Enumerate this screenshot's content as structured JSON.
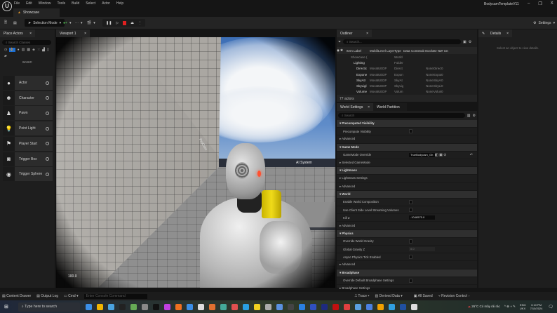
{
  "app": {
    "project_title": "BodycamTemplateV11",
    "level_tab": "Showcase"
  },
  "menu": [
    "File",
    "Edit",
    "Window",
    "Tools",
    "Build",
    "Select",
    "Actor",
    "Help"
  ],
  "toolbar": {
    "selection_mode": "Selection Mode",
    "settings": "Settings"
  },
  "place_actors": {
    "tab": "Place Actors",
    "search_placeholder": "Search Classes",
    "section": "BASIC",
    "items": [
      {
        "label": "Actor",
        "icon": "sphere-icon"
      },
      {
        "label": "Character",
        "icon": "character-icon"
      },
      {
        "label": "Pawn",
        "icon": "pawn-icon"
      },
      {
        "label": "Point Light",
        "icon": "light-bulb-icon"
      },
      {
        "label": "Player Start",
        "icon": "flag-icon"
      },
      {
        "label": "Trigger Box",
        "icon": "trigger-box-icon"
      },
      {
        "label": "Trigger Sphere",
        "icon": "trigger-sphere-icon"
      }
    ]
  },
  "viewport": {
    "tab": "Viewport 1",
    "world_text_1": "AI System",
    "world_text_2": "ProCam",
    "fov_readout": "100.0"
  },
  "outliner": {
    "tab": "Outliner",
    "search_placeholder": "Search...",
    "columns": [
      "Item Label",
      "Mobilit",
      "Level",
      "Layer",
      "Type",
      "Data L",
      "Conten",
      "Sub Pa",
      "Socket",
      "ID Nam",
      "# Unca"
    ],
    "rows": [
      [
        "Showcase (",
        "",
        "",
        "",
        "World",
        "",
        "",
        "",
        "",
        "",
        ""
      ],
      [
        "Lighting",
        "",
        "",
        "",
        "Folder",
        "",
        "",
        "",
        "",
        "",
        ""
      ],
      [
        "Directic",
        "Movat",
        "UEDPI",
        "",
        "Direct",
        "",
        "",
        "",
        "None",
        "Directi",
        "0"
      ],
      [
        "Expone",
        "Movat",
        "UEDPI",
        "",
        "Expon",
        "",
        "",
        "",
        "None",
        "Expon",
        "0"
      ],
      [
        "SkyAtr",
        "Movat",
        "UEDPI",
        "",
        "SkyAt",
        "",
        "",
        "",
        "None",
        "SkyAt",
        "0"
      ],
      [
        "SkyLigl",
        "Movat",
        "UEDPI",
        "",
        "SkyLig",
        "",
        "",
        "",
        "None",
        "SkyLig",
        "0"
      ],
      [
        "Volume",
        "Movat",
        "UEDPI",
        "",
        "Volum",
        "",
        "",
        "",
        "None",
        "Volum",
        "0"
      ]
    ],
    "count": "77 actors"
  },
  "world_settings": {
    "tab": "World Settings",
    "tab2": "World Partition",
    "search_placeholder": "Search",
    "rows": [
      {
        "type": "cat",
        "label": "Precomputed Visibility"
      },
      {
        "type": "chk",
        "label": "Precompute Visibility"
      },
      {
        "type": "sub",
        "label": "Advanced"
      },
      {
        "type": "cat",
        "label": "Game Mode"
      },
      {
        "type": "drop",
        "label": "GameMode Override",
        "value": "TrueBodycam_Gh"
      },
      {
        "type": "sub",
        "label": "Selected GameMode"
      },
      {
        "type": "cat",
        "label": "Lightmass"
      },
      {
        "type": "sub",
        "label": "Lightmass Settings"
      },
      {
        "type": "sub",
        "label": "Advanced"
      },
      {
        "type": "cat",
        "label": "World"
      },
      {
        "type": "chk",
        "label": "Enable World Composition"
      },
      {
        "type": "chk",
        "label": "Use Client Side Level Streaming Volumes"
      },
      {
        "type": "num",
        "label": "Kill Z",
        "value": "-1048575.0"
      },
      {
        "type": "sub",
        "label": "Advanced"
      },
      {
        "type": "cat",
        "label": "Physics"
      },
      {
        "type": "chk",
        "label": "Override World Gravity"
      },
      {
        "type": "numdis",
        "label": "Global Gravity Z",
        "value": "0.0"
      },
      {
        "type": "chk",
        "label": "Async Physics Tick Enabled"
      },
      {
        "type": "sub",
        "label": "Advanced"
      },
      {
        "type": "cat",
        "label": "Broadphase"
      },
      {
        "type": "chk",
        "label": "Override Default Broadphase Settings"
      },
      {
        "type": "sub",
        "label": "Broadphase Settings"
      }
    ]
  },
  "details": {
    "tab": "Details",
    "empty": "Select an object to view details."
  },
  "statusbar": {
    "content_drawer": "Content Drawer",
    "output_log": "Output Log",
    "cmd": "Cmd",
    "console_placeholder": "Enter Console Command",
    "trace": "Trace",
    "derived_data": "Derived Data",
    "all_saved": "All Saved",
    "revision_control": "Revision Control"
  },
  "taskbar": {
    "search": "Type here to search",
    "weather": "26°C  Có mây rải rác",
    "lang1": "ENG",
    "lang2": "UKX",
    "time": "3:10 PM",
    "date": "7/10/2024",
    "icon_colors": [
      "#3a8ee6",
      "#f0b400",
      "#4aa3df",
      "#222",
      "#6a5",
      "#888",
      "#111",
      "#c040e0",
      "#f07020",
      "#3a8ee6",
      "#ddd",
      "#e07030",
      "#4a9",
      "#e05050",
      "#2aa0e0",
      "#f0d020",
      "#aaa",
      "#5a90e0",
      "#444",
      "#2a80e0",
      "#3050c0",
      "#1e2a80",
      "#c01010",
      "#e04040",
      "#5aa0e0",
      "#4a80e0",
      "#f0a000",
      "#30a0e0",
      "#2050a0",
      "#ddd"
    ]
  }
}
